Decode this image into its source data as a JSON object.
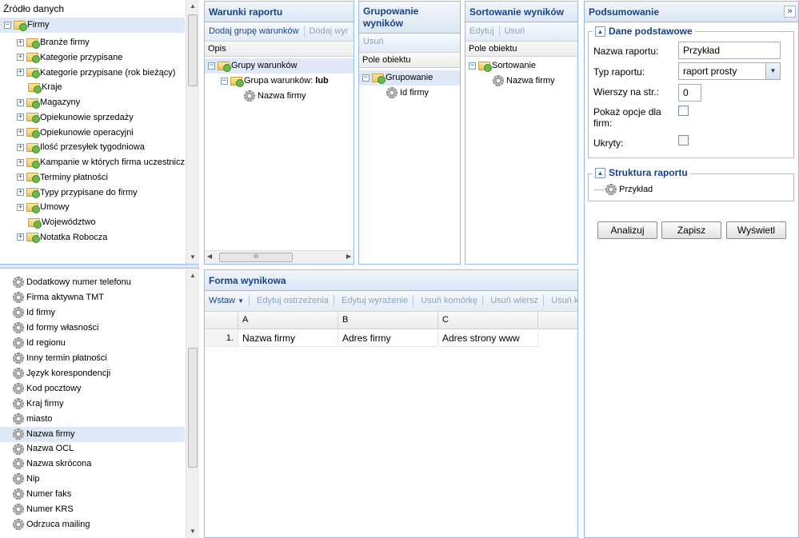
{
  "source": {
    "title": "Źródło danych",
    "tree_root": "Firmy",
    "tree_items": [
      {
        "label": "Branże firmy",
        "expandable": true
      },
      {
        "label": "Kategorie przypisane",
        "expandable": true
      },
      {
        "label": "Kategorie przypisane (rok bieżący)",
        "expandable": true
      },
      {
        "label": "Kraje",
        "expandable": false
      },
      {
        "label": "Magazyny",
        "expandable": true
      },
      {
        "label": "Opiekunowie sprzedaży",
        "expandable": true
      },
      {
        "label": "Opiekunowie operacyjni",
        "expandable": true
      },
      {
        "label": "Ilość przesyłek tygodniowa",
        "expandable": true
      },
      {
        "label": "Kampanie w których firma uczestniczy",
        "expandable": true
      },
      {
        "label": "Terminy płatności",
        "expandable": true
      },
      {
        "label": "Typy przypisane do firmy",
        "expandable": true
      },
      {
        "label": "Umowy",
        "expandable": true
      },
      {
        "label": "Województwo",
        "expandable": false
      },
      {
        "label": "Notatka Robocza",
        "expandable": true
      }
    ],
    "fields": [
      "Dodatkowy numer telefonu",
      "Firma aktywna TMT",
      "Id firmy",
      "Id formy własności",
      "Id regionu",
      "Inny termin płatności",
      "Język korespondencji",
      "Kod pocztowy",
      "Kraj firmy",
      "miasto",
      "Nazwa firmy",
      "Nazwa OCL",
      "Nazwa skrócona",
      "Nip",
      "Numer faks",
      "Numer KRS",
      "Odrzuca mailing"
    ],
    "selected_field": "Nazwa firmy"
  },
  "conditions": {
    "title": "Warunki raportu",
    "add_group": "Dodaj grupę warunków",
    "add_other": "Dodaj wyr",
    "col_header": "Opis",
    "root": "Grupy warunków",
    "group_label": "Grupa warunków:",
    "group_op": "lub",
    "leaf": "Nazwa firmy",
    "hscroll_grip": "III"
  },
  "grouping": {
    "title_line1": "Grupowanie",
    "title_line2": "wyników",
    "remove": "Usuń",
    "col_header": "Pole obiektu",
    "root": "Grupowanie",
    "leaf": "Id firmy"
  },
  "sorting": {
    "title": "Sortowanie wyników",
    "edit": "Edytuj",
    "remove": "Usuń",
    "col_header": "Pole obiektu",
    "root": "Sortowanie",
    "leaf": "Nazwa firmy"
  },
  "output": {
    "title": "Forma wynikowa",
    "insert": "Wstaw",
    "toolbar": [
      "Edytuj ostrzeżenia",
      "Edytuj wyrażenie",
      "Usuń komórkę",
      "Usuń wiersz",
      "Usuń kolu"
    ],
    "columns": [
      "A",
      "B",
      "C"
    ],
    "row_num": "1.",
    "row": [
      "Nazwa firmy",
      "Adres firmy",
      "Adres strony www"
    ]
  },
  "summary": {
    "title": "Podsumowanie",
    "collapse": "»",
    "basic_title": "Dane podstawowe",
    "name_label": "Nazwa raportu:",
    "name_value": "Przykład",
    "type_label": "Typ raportu:",
    "type_value": "raport prosty",
    "rows_label": "Wierszy na str.:",
    "rows_value": "0",
    "opts_label_1": "Pokaż opcje dla",
    "opts_label_2": "firm:",
    "hidden_label": "Ukryty:",
    "structure_title": "Struktura raportu",
    "structure_item": "Przykład",
    "btn_analyze": "Analizuj",
    "btn_save": "Zapisz",
    "btn_show": "Wyświetl"
  }
}
